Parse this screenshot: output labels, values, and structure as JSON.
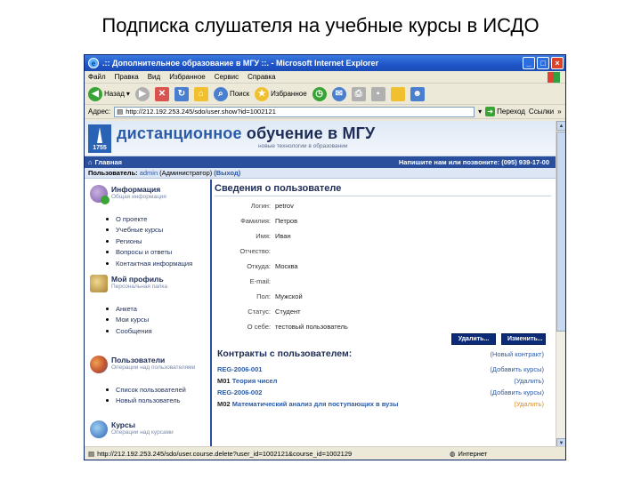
{
  "slide": {
    "title": "Подписка слушателя на учебные курсы в ИСДО"
  },
  "window": {
    "title": ".:: Дополнительное образование в МГУ ::. - Microsoft Internet Explorer",
    "menu": [
      "Файл",
      "Правка",
      "Вид",
      "Избранное",
      "Сервис",
      "Справка"
    ],
    "toolbar": {
      "back": "Назад",
      "search": "Поиск",
      "favorites": "Избранное"
    },
    "address_label": "Адрес:",
    "address_value": "http://212.192.253.245/sdo/user.show?id=1002121",
    "go_label": "Переход",
    "links_label": "Ссылки",
    "status_text": "http://212.192.253.245/sdo/user.course.delete?user_id=1002121&course_id=1002129",
    "zone_label": "Интернет"
  },
  "site": {
    "logo_year": "1755",
    "title_part1": "дистанционное",
    "title_part2": " обучение в ",
    "title_part3": "МГУ",
    "subtitle": "новые технологии в образовании",
    "nav_home": "Главная",
    "contact": "Напишите нам или позвоните: (095) 939-17-00",
    "user_label": "Пользователь:",
    "user_name": "admin",
    "user_role": "(Администратор)",
    "logout": "(Выход)"
  },
  "sidebar": {
    "sections": [
      {
        "title": "Информация",
        "subtitle": "Общая информация",
        "items": [
          "О проекте",
          "Учебные курсы",
          "Регионы",
          "Вопросы и ответы",
          "Контактная информация"
        ]
      },
      {
        "title": "Мой профиль",
        "subtitle": "Персональная папка",
        "items": [
          "Анкета",
          "Мои курсы",
          "Сообщения"
        ]
      },
      {
        "title": "Пользователи",
        "subtitle": "Операции над пользователями",
        "items": [
          "Список пользователей",
          "Новый пользователь"
        ]
      },
      {
        "title": "Курсы",
        "subtitle": "Операции над курсами",
        "items": []
      }
    ]
  },
  "user_info": {
    "title": "Сведения о пользователе",
    "fields": [
      {
        "label": "Логин:",
        "value": "petrov"
      },
      {
        "label": "Фамилия:",
        "value": "Петров"
      },
      {
        "label": "Имя:",
        "value": "Иван"
      },
      {
        "label": "Отчество:",
        "value": ""
      },
      {
        "label": "Откуда:",
        "value": "Москва"
      },
      {
        "label": "E-mail:",
        "value": ""
      },
      {
        "label": "Пол:",
        "value": "Мужской"
      },
      {
        "label": "Статус:",
        "value": "Студент"
      },
      {
        "label": "О себе:",
        "value": "тестовый пользователь"
      }
    ],
    "delete_button": "Удалить...",
    "edit_button": "Изменить..."
  },
  "contracts": {
    "title": "Контракты с пользователем:",
    "new_contract": "(Новый контракт)",
    "rows": [
      {
        "code": "REG-2006-001",
        "action": "(Добавить курсы)",
        "module": "M01",
        "module_name": "Теория чисел",
        "module_action": "(Удалить)"
      },
      {
        "code": "REG-2006-002",
        "action": "(Добавить курсы)",
        "module": "M02",
        "module_name": "Математический анализ для поступающих в вузы",
        "module_action": "(Удалить)"
      }
    ]
  }
}
